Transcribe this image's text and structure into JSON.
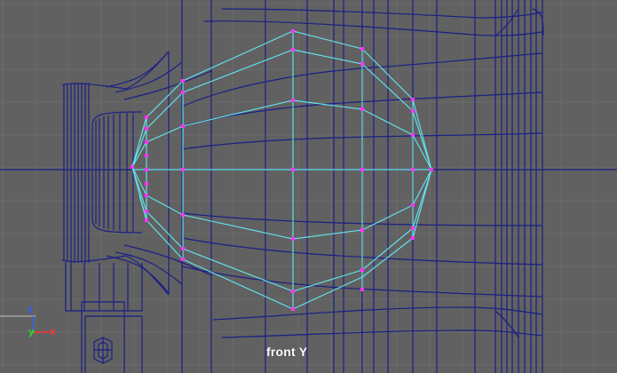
{
  "viewport": {
    "camera_label": "front Y"
  },
  "axis_gizmo": {
    "z_label": "z",
    "y_label": "y",
    "x_label": "x",
    "colors": {
      "z": "#2f62ff",
      "y": "#33d233",
      "x": "#ff3434"
    }
  },
  "colors": {
    "background": "#616161",
    "grid": "#6d6d6d",
    "wire": "#1b1f86",
    "selected_wire": "#66e6ef",
    "vertex": "#ff33ff"
  }
}
